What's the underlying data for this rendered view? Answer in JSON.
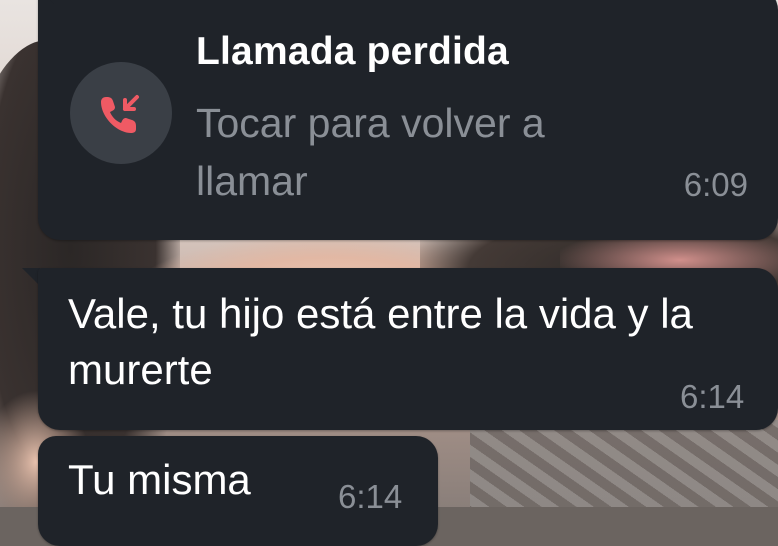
{
  "missed_call": {
    "title": "Llamada perdida",
    "subtitle": "Tocar para volver a llamar",
    "time": "6:09",
    "icon": "missed-call-icon",
    "icon_color": "#ef5a64"
  },
  "messages": [
    {
      "text": "Vale, tu hijo está entre la vida y la murerte",
      "time": "6:14"
    },
    {
      "text": "Tu misma",
      "time": "6:14"
    }
  ],
  "colors": {
    "bubble": "#1f2329",
    "text": "#ffffff",
    "muted": "#8a8f96"
  }
}
